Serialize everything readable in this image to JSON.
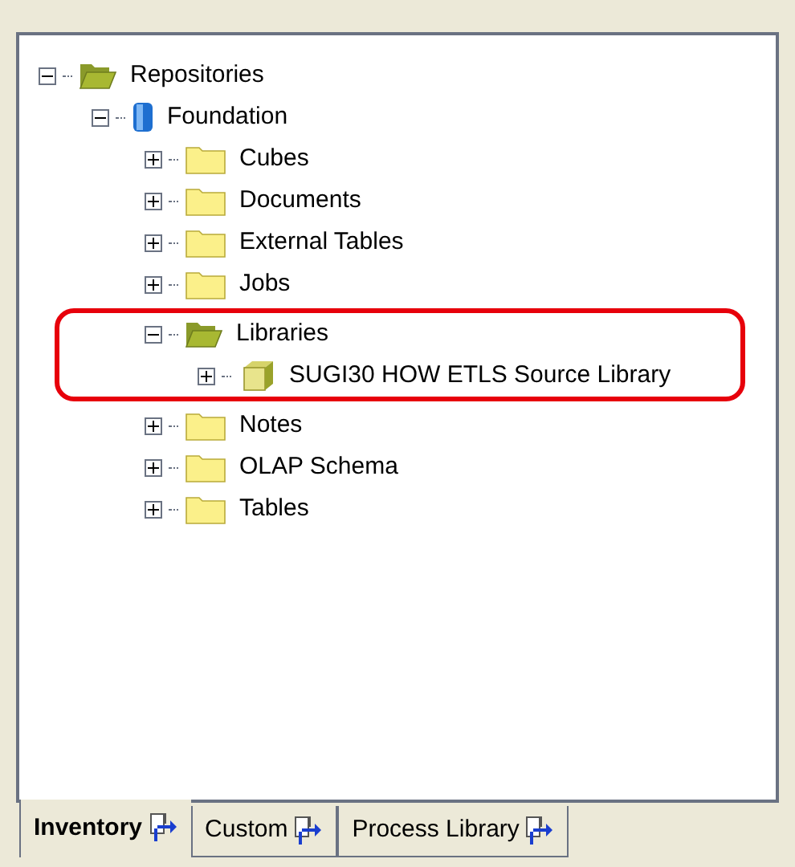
{
  "tree": [
    {
      "label": "Repositories",
      "kind": "open-folder",
      "expanded": true,
      "highlighted": false,
      "children": [
        {
          "label": "Foundation",
          "kind": "database",
          "expanded": true,
          "highlighted": false,
          "children": [
            {
              "label": "Cubes",
              "kind": "folder",
              "expanded": false,
              "highlighted": false
            },
            {
              "label": "Documents",
              "kind": "folder",
              "expanded": false,
              "highlighted": false
            },
            {
              "label": "External Tables",
              "kind": "folder",
              "expanded": false,
              "highlighted": false
            },
            {
              "label": "Jobs",
              "kind": "folder",
              "expanded": false,
              "highlighted": false
            },
            {
              "label": "Libraries",
              "kind": "open-folder",
              "expanded": true,
              "highlighted": true,
              "children": [
                {
                  "label": "SUGI30 HOW ETLS Source Library",
                  "kind": "library",
                  "expanded": false,
                  "highlighted": false
                }
              ]
            },
            {
              "label": "Notes",
              "kind": "folder",
              "expanded": false,
              "highlighted": false
            },
            {
              "label": "OLAP Schema",
              "kind": "folder",
              "expanded": false,
              "highlighted": false
            },
            {
              "label": "Tables",
              "kind": "folder",
              "expanded": false,
              "highlighted": false
            }
          ]
        }
      ]
    }
  ],
  "tabs": [
    {
      "label": "Inventory",
      "selected": true
    },
    {
      "label": "Custom",
      "selected": false
    },
    {
      "label": "Process Library",
      "selected": false
    }
  ]
}
